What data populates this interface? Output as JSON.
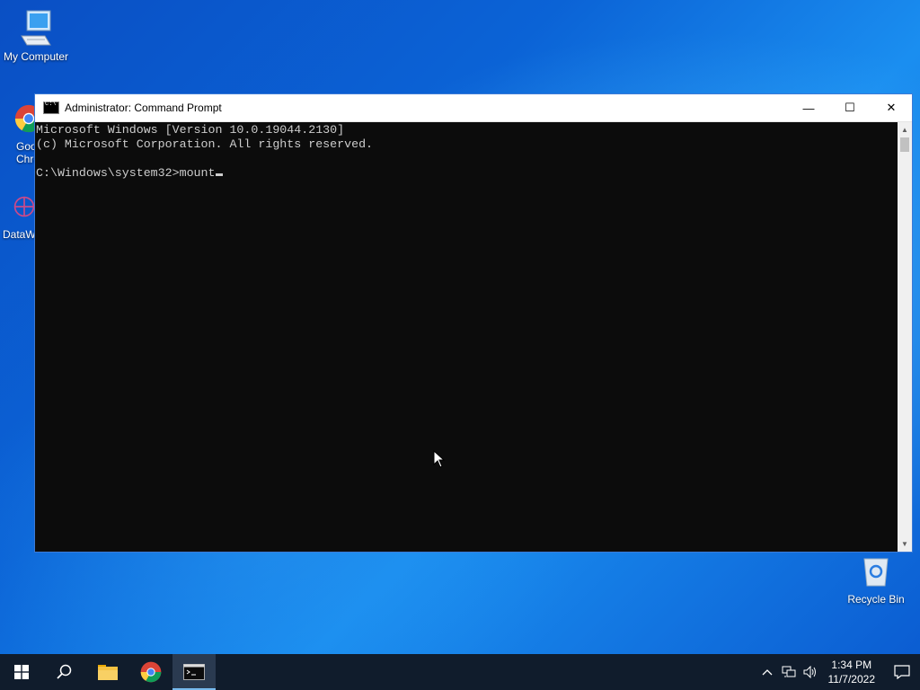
{
  "desktop": {
    "icons": [
      {
        "label": "My Computer"
      },
      {
        "label": "Google Chrome"
      },
      {
        "label": "DataWarrior"
      },
      {
        "label": "Recycle Bin"
      }
    ]
  },
  "window": {
    "title": "Administrator: Command Prompt",
    "minimize_symbol": "—",
    "maximize_symbol": "☐",
    "close_symbol": "✕",
    "console_lines": [
      "Microsoft Windows [Version 10.0.19044.2130]",
      "(c) Microsoft Corporation. All rights reserved.",
      "",
      "C:\\Windows\\system32>mount"
    ]
  },
  "taskbar": {
    "clock_time": "1:34 PM",
    "clock_date": "11/7/2022",
    "pinned": [
      "start-button",
      "search-button",
      "file-explorer",
      "chrome",
      "command-prompt"
    ]
  },
  "colors": {
    "console_bg": "#0c0c0c",
    "console_fg": "#cccccc",
    "taskbar_bg": "#101c2c",
    "accent": "#76b9ed"
  }
}
